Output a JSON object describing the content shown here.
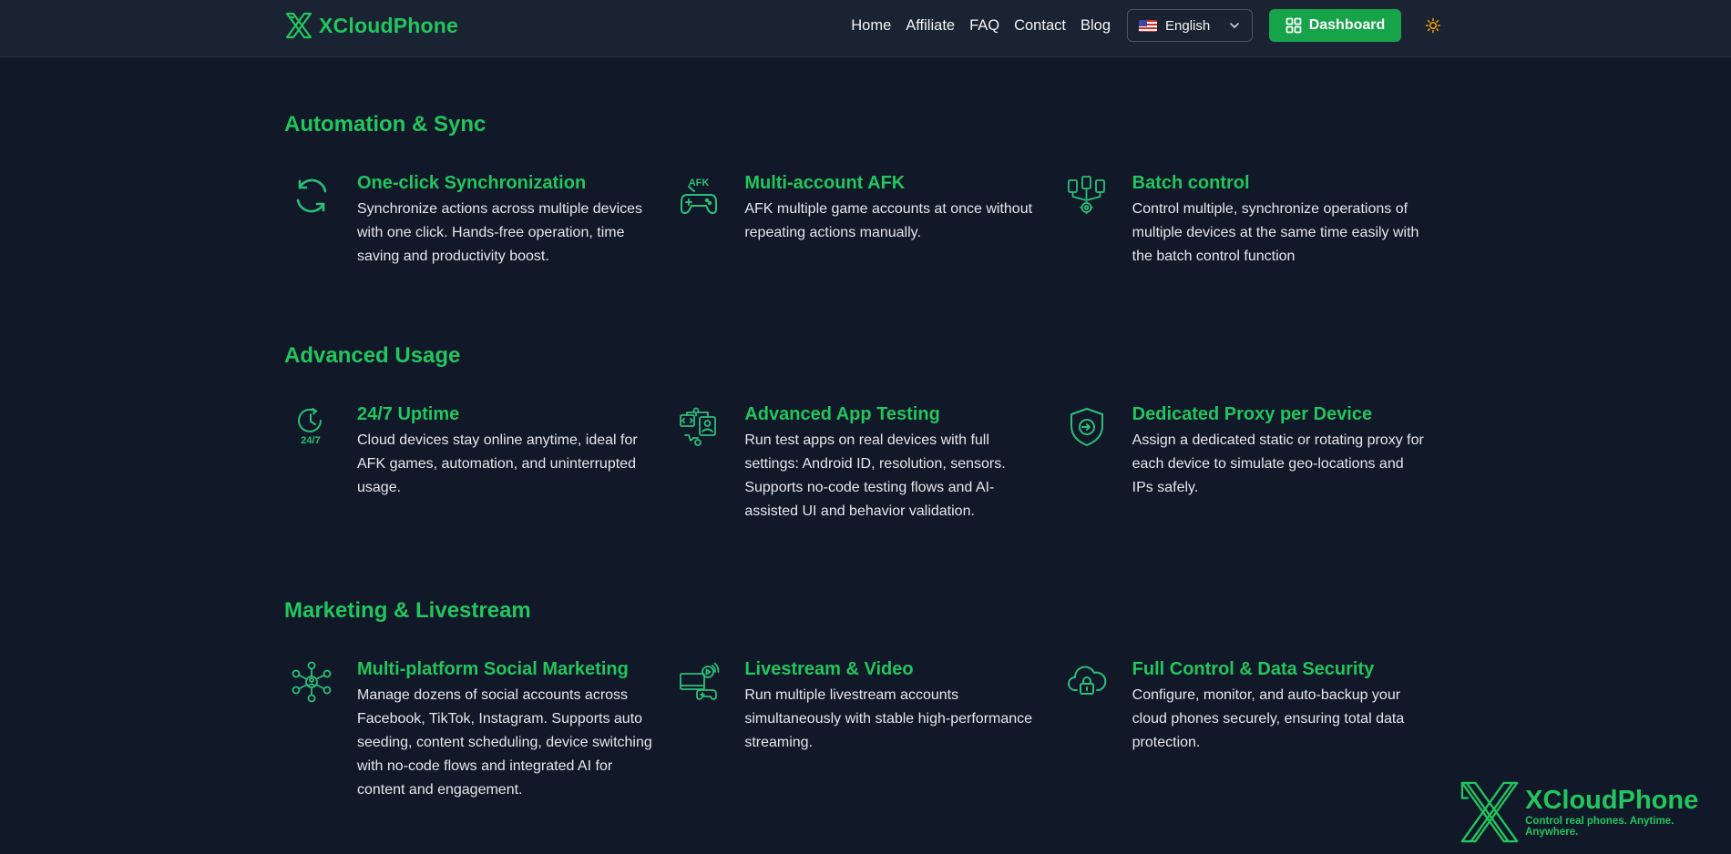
{
  "header": {
    "brand": "XCloudPhone",
    "nav": [
      "Home",
      "Affiliate",
      "FAQ",
      "Contact",
      "Blog"
    ],
    "language": {
      "label": "English",
      "flag_icon": "us-flag-icon"
    },
    "dashboard_label": "Dashboard",
    "theme_icon": "sun-icon"
  },
  "colors": {
    "accent": "#22c55e",
    "button": "#16a34a",
    "background": "#111827",
    "header": "#1a2332"
  },
  "sections": [
    {
      "title": "Automation & Sync",
      "features": [
        {
          "icon": "sync-icon",
          "title": "One-click Synchronization",
          "desc": "Synchronize actions across multiple devices with one click. Hands-free operation, time saving and productivity boost."
        },
        {
          "icon": "afk-gamepad-icon",
          "icon_text": "AFK",
          "title": "Multi-account AFK",
          "desc": "AFK multiple game accounts at once without repeating actions manually."
        },
        {
          "icon": "batch-devices-icon",
          "title": "Batch control",
          "desc": "Control multiple, synchronize operations of multiple devices at the same time easily with the batch control function"
        }
      ]
    },
    {
      "title": "Advanced Usage",
      "features": [
        {
          "icon": "uptime-clock-icon",
          "icon_text": "24/7",
          "title": "24/7 Uptime",
          "desc": "Cloud devices stay online anytime, ideal for AFK games, automation, and uninterrupted usage."
        },
        {
          "icon": "app-testing-icon",
          "title": "Advanced App Testing",
          "desc": "Run test apps on real devices with full settings: Android ID, resolution, sensors. Supports no-code testing flows and AI-assisted UI and behavior validation."
        },
        {
          "icon": "proxy-shield-icon",
          "title": "Dedicated Proxy per Device",
          "desc": "Assign a dedicated static or rotating proxy for each device to simulate geo-locations and IPs safely."
        }
      ]
    },
    {
      "title": "Marketing & Livestream",
      "features": [
        {
          "icon": "social-network-icon",
          "title": "Multi-platform Social Marketing",
          "desc": "Manage dozens of social accounts across Facebook, TikTok, Instagram. Supports auto seeding, content scheduling, device switching with no-code flows and integrated AI for content and engagement."
        },
        {
          "icon": "livestream-icon",
          "title": "Livestream & Video",
          "desc": "Run multiple livestream accounts simultaneously with stable high-performance streaming."
        },
        {
          "icon": "cloud-lock-icon",
          "title": "Full Control & Data Security",
          "desc": "Configure, monitor, and auto-backup your cloud phones securely, ensuring total data protection."
        }
      ]
    }
  ],
  "floating_logo": {
    "name": "XCloudPhone",
    "tagline": "Control real phones. Anytime. Anywhere."
  }
}
